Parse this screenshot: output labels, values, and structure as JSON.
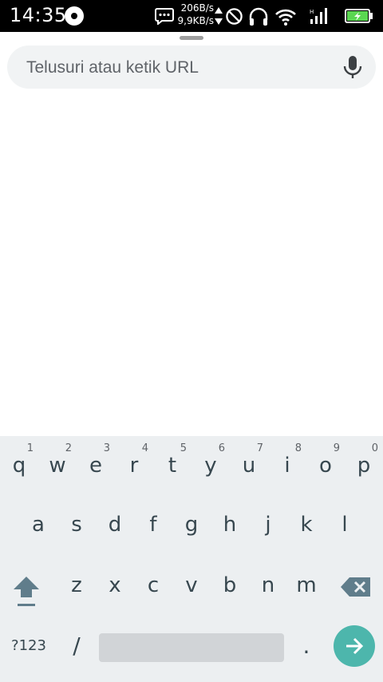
{
  "status_bar": {
    "time": "14:35",
    "upload_speed": "206B/s",
    "download_speed": "9,9KB/s",
    "icons": [
      "screen-record-icon",
      "message-icon",
      "data-arrows-icon",
      "do-not-disturb-icon",
      "headphones-icon",
      "wifi-icon",
      "signal-icon",
      "battery-charging-icon"
    ]
  },
  "search": {
    "placeholder": "Telusuri atau ketik URL",
    "value": ""
  },
  "keyboard": {
    "row1": [
      {
        "key": "q",
        "hint": "1"
      },
      {
        "key": "w",
        "hint": "2"
      },
      {
        "key": "e",
        "hint": "3"
      },
      {
        "key": "r",
        "hint": "4"
      },
      {
        "key": "t",
        "hint": "5"
      },
      {
        "key": "y",
        "hint": "6"
      },
      {
        "key": "u",
        "hint": "7"
      },
      {
        "key": "i",
        "hint": "8"
      },
      {
        "key": "o",
        "hint": "9"
      },
      {
        "key": "p",
        "hint": "0"
      }
    ],
    "row2": [
      "a",
      "s",
      "d",
      "f",
      "g",
      "h",
      "j",
      "k",
      "l"
    ],
    "row3": [
      "z",
      "x",
      "c",
      "v",
      "b",
      "n",
      "m"
    ],
    "symbols_label": "?123",
    "slash_label": "/",
    "period_label": ".",
    "accent_color": "#4db6ac"
  }
}
